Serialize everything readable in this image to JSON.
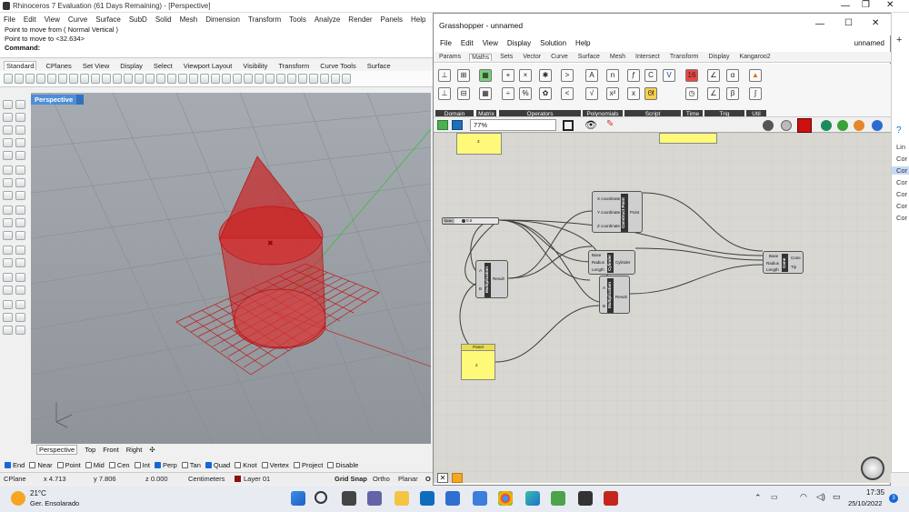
{
  "rhino": {
    "title": "Rhinoceros 7 Evaluation (61 Days Remaining) - [Perspective]",
    "menu": [
      "File",
      "Edit",
      "View",
      "Curve",
      "Surface",
      "SubD",
      "Solid",
      "Mesh",
      "Dimension",
      "Transform",
      "Tools",
      "Analyze",
      "Render",
      "Panels",
      "Help"
    ],
    "command_lines": [
      "Point to move from ( Normal  Vertical )",
      "Point to move to <32.634>",
      "Command:"
    ],
    "toolbar_tabs": [
      "Standard",
      "CPlanes",
      "Set View",
      "Display",
      "Select",
      "Viewport Layout",
      "Visibility",
      "Transform",
      "Curve Tools",
      "Surface"
    ],
    "viewport_label": "Perspective",
    "viewport_tabs": [
      "Perspective",
      "Top",
      "Front",
      "Right"
    ],
    "osnaps": [
      {
        "label": "End",
        "on": true
      },
      {
        "label": "Near",
        "on": false
      },
      {
        "label": "Point",
        "on": false
      },
      {
        "label": "Mid",
        "on": false
      },
      {
        "label": "Cen",
        "on": false
      },
      {
        "label": "Int",
        "on": false
      },
      {
        "label": "Perp",
        "on": true
      },
      {
        "label": "Tan",
        "on": false
      },
      {
        "label": "Quad",
        "on": true
      },
      {
        "label": "Knot",
        "on": false
      },
      {
        "label": "Vertex",
        "on": false
      },
      {
        "label": "Project",
        "on": false
      },
      {
        "label": "Disable",
        "on": false
      }
    ],
    "status": {
      "cplane": "CPlane",
      "x": "x 4.713",
      "y": "y 7.806",
      "z": "z 0.000",
      "units": "Centimeters",
      "layer": "Layer 01",
      "gridsnap": "Grid Snap",
      "ortho": "Ortho",
      "planar": "Planar",
      "osnap": "O"
    }
  },
  "gh": {
    "title": "Grasshopper - unnamed",
    "menu": [
      "File",
      "Edit",
      "View",
      "Display",
      "Solution",
      "Help"
    ],
    "doc_name": "unnamed",
    "tabs": [
      "Params",
      "Maths",
      "Sets",
      "Vector",
      "Curve",
      "Surface",
      "Mesh",
      "Intersect",
      "Transform",
      "Display",
      "Kangaroo2"
    ],
    "groups": [
      "Domain",
      "Matrix",
      "Operators",
      "Polynomials",
      "Script",
      "Time",
      "Trig",
      "Util"
    ],
    "zoom": "77%",
    "nodes": {
      "construct_point": {
        "name": "Construct Point",
        "inputs": [
          "X coordinate",
          "Y coordinate",
          "Z coordinate"
        ],
        "output": "Point"
      },
      "slider": {
        "label": "Slider",
        "value": "0.5"
      },
      "cylinder": {
        "name": "Cylinder",
        "inputs": [
          "Base",
          "Radius",
          "Length"
        ],
        "output": "Cylinder"
      },
      "cone": {
        "name": "Cone",
        "inputs": [
          "Base",
          "Radius",
          "Length"
        ],
        "outputs": [
          "Cone",
          "Tip"
        ]
      },
      "mult1": {
        "name": "Multiplication",
        "inputs": [
          "A",
          "B"
        ],
        "output": "Result"
      },
      "mult2": {
        "name": "Multiplication",
        "inputs": [
          "A",
          "B"
        ],
        "output": "Result"
      },
      "panel": {
        "label": "Panel",
        "value": "2"
      },
      "panel_top": {
        "value": "3"
      }
    },
    "right_list": [
      "Lin",
      "Cor",
      "Cor",
      "Cor",
      "Cor",
      "Cor",
      "Cor"
    ]
  },
  "taskbar": {
    "weather_temp": "21°C",
    "weather_desc": "Ger. Ensolarado",
    "time": "17:35",
    "date": "25/10/2022",
    "badge": "3"
  }
}
